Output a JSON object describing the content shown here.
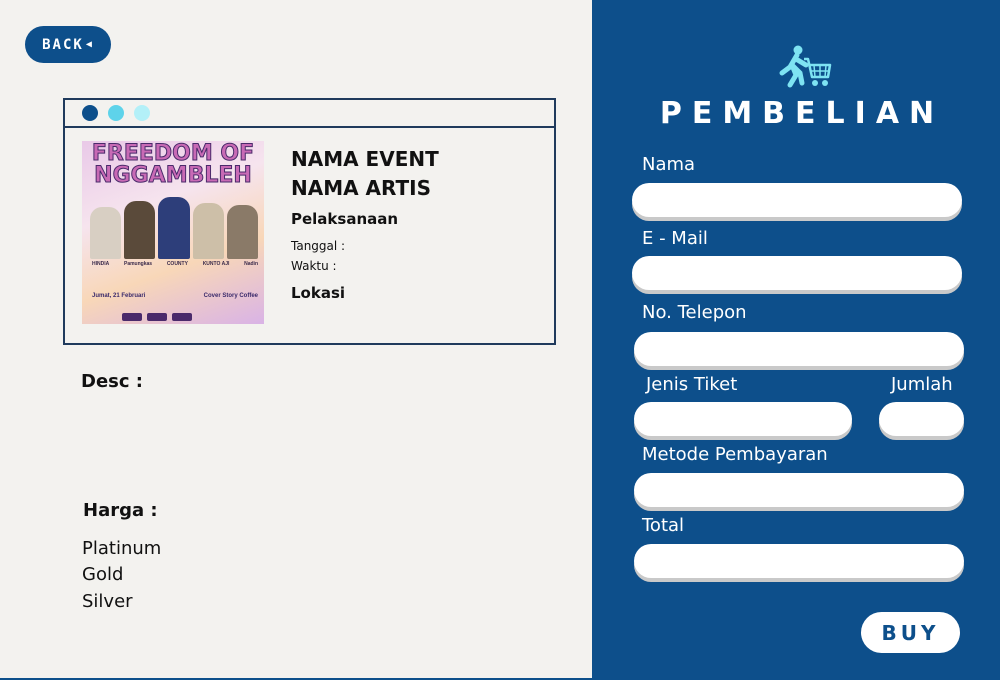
{
  "nav": {
    "back_label": "BACK",
    "back_icon": "triangle-left-icon"
  },
  "event_card": {
    "window_dots": [
      "#0d4f8b",
      "#5ed3ea",
      "#b3f0f8"
    ],
    "poster": {
      "title": "FREEDOM OF NGGAMBLEH",
      "performers": [
        "HINDIA",
        "Pamungkas",
        "COUNTY",
        "KUNTO AJI",
        "Nadin"
      ],
      "date_text": "Jumat, 21 Februari",
      "venue_text": "Cover Story Coffee"
    },
    "event_name": "NAMA EVENT",
    "artist_name": "NAMA ARTIS",
    "pelaksanaan_label": "Pelaksanaan",
    "tanggal_label": "Tanggal :",
    "waktu_label": "Waktu  :",
    "lokasi_label": "Lokasi"
  },
  "desc_label": "Desc :",
  "harga": {
    "label": "Harga :",
    "tiers": [
      "Platinum",
      "Gold",
      "Silver"
    ]
  },
  "purchase": {
    "title": "PEMBELIAN",
    "icon": "person-cart-icon",
    "fields": {
      "nama": {
        "label": "Nama",
        "value": ""
      },
      "email": {
        "label": "E - Mail",
        "value": ""
      },
      "telepon": {
        "label": "No. Telepon",
        "value": ""
      },
      "jenis_tiket": {
        "label": "Jenis Tiket",
        "value": ""
      },
      "jumlah": {
        "label": "Jumlah",
        "value": ""
      },
      "metode": {
        "label": "Metode Pembayaran",
        "value": ""
      },
      "total": {
        "label": "Total",
        "value": ""
      }
    },
    "buy_label": "BUY"
  },
  "colors": {
    "primary": "#0d4f8b",
    "background": "#f3f2ef",
    "accent": "#5ed3ea"
  }
}
